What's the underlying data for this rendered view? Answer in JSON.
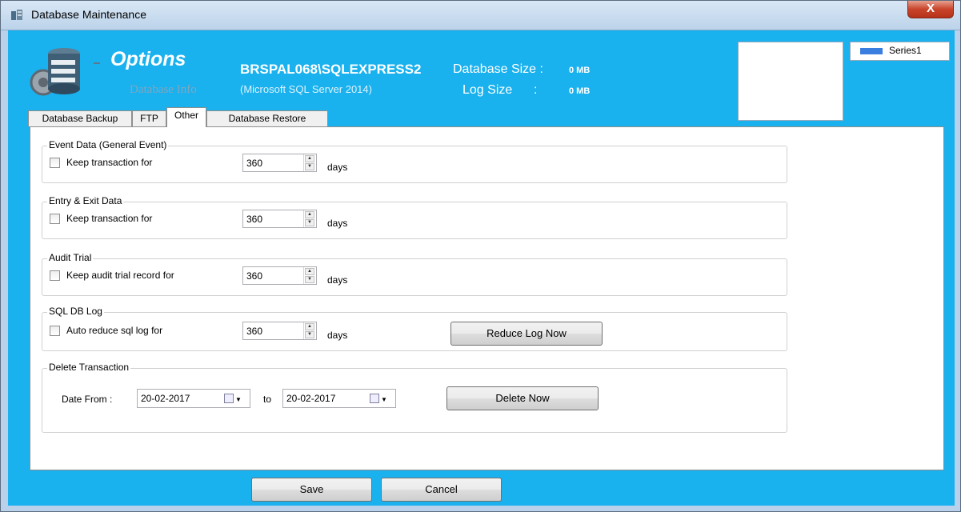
{
  "window": {
    "title": "Database Maintenance",
    "close_glyph": "X"
  },
  "header": {
    "options_title": "Options",
    "database_info_label": "Database Info",
    "server_name": "BRSPAL068\\SQLEXPRESS2",
    "server_version": "(Microsoft SQL Server 2014)",
    "database_size_label": "Database Size :",
    "database_size_value": "0 MB",
    "log_size_label": "Log Size",
    "log_size_colon": ":",
    "log_size_value": "0 MB",
    "legend_series": "Series1"
  },
  "tabs": [
    {
      "label": "Database Backup"
    },
    {
      "label": "FTP"
    },
    {
      "label": "Other"
    },
    {
      "label": "Database Restore"
    }
  ],
  "groups": {
    "event": {
      "title": "Event Data (General Event)",
      "checkbox_label": "Keep transaction for",
      "value": "360",
      "unit": "days"
    },
    "entry_exit": {
      "title": "Entry & Exit Data",
      "checkbox_label": "Keep transaction for",
      "value": "360",
      "unit": "days"
    },
    "audit": {
      "title": "Audit Trial",
      "checkbox_label": "Keep audit trial record for",
      "value": "360",
      "unit": "days"
    },
    "sql_log": {
      "title": "SQL DB Log",
      "checkbox_label": "Auto reduce sql log for",
      "value": "360",
      "unit": "days",
      "button": "Reduce Log Now"
    },
    "delete": {
      "title": "Delete Transaction",
      "date_from_label": "Date From :",
      "date_from": "20-02-2017",
      "to_label": "to",
      "date_to": "20-02-2017",
      "button": "Delete Now"
    }
  },
  "footer": {
    "save": "Save",
    "cancel": "Cancel"
  },
  "colors": {
    "header_bg": "#19b1ee",
    "legend_swatch": "#3a7ee0",
    "close_button": "#c8442b"
  }
}
